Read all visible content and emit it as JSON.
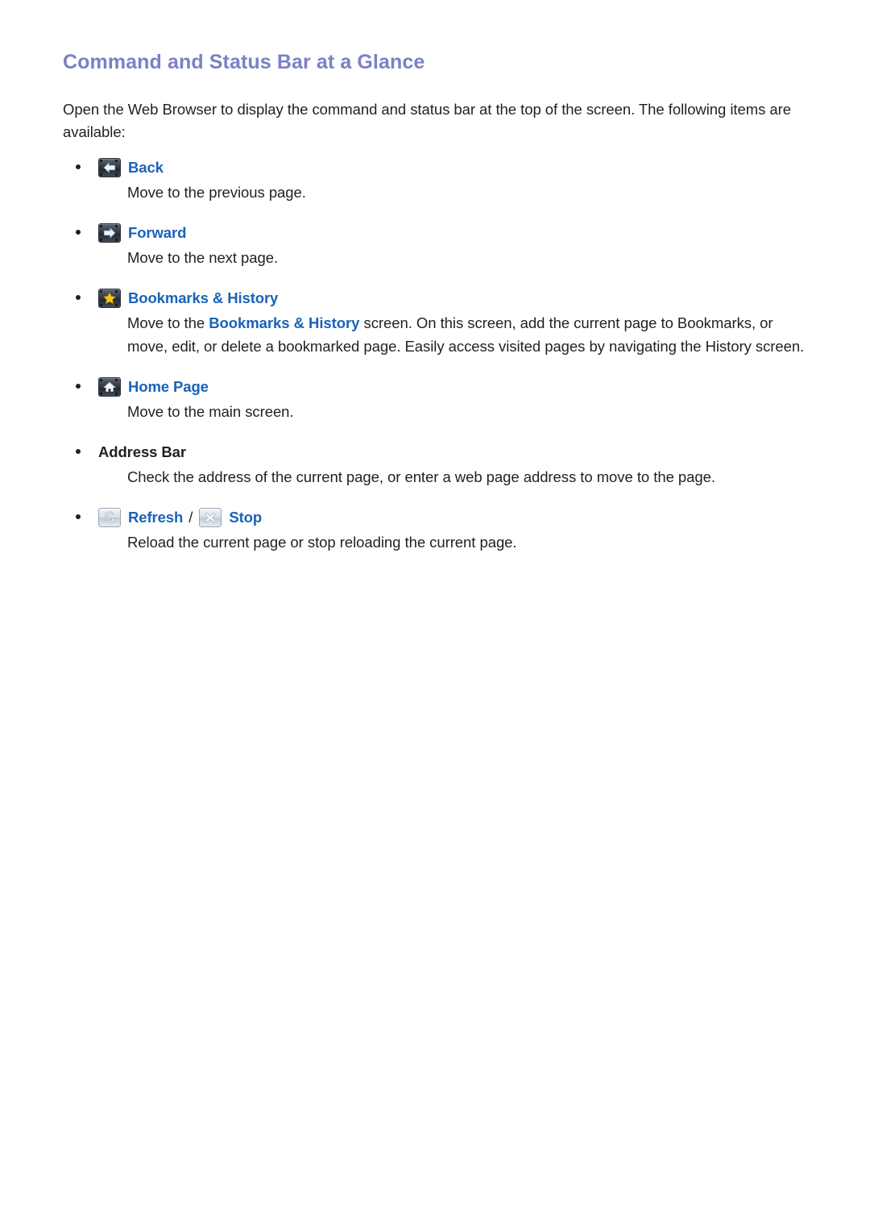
{
  "page": {
    "title": "Command and Status Bar at a Glance",
    "intro": "Open the Web Browser to display the command and status bar at the top of the screen. The following items are available:"
  },
  "colors": {
    "heading": "#7b80c6",
    "link": "#1a62b8",
    "body_text": "#231f20",
    "icon_dark": "#2b313a",
    "icon_light": "#d9e0e7",
    "star_yellow": "#f5c518"
  },
  "items": [
    {
      "icon": "back-arrow-icon",
      "label": "Back",
      "description": "Move to the previous page."
    },
    {
      "icon": "forward-arrow-icon",
      "label": "Forward",
      "description": "Move to the next page."
    },
    {
      "icon": "star-bookmark-icon",
      "label": "Bookmarks & History",
      "description_prefix": "Move to the ",
      "description_highlight": "Bookmarks & History",
      "description_suffix": " screen. On this screen, add the current page to Bookmarks, or move, edit, or delete a bookmarked page. Easily access visited pages by navigating the History screen."
    },
    {
      "icon": "home-icon",
      "label": "Home Page",
      "description": "Move to the main screen."
    },
    {
      "icon": null,
      "label": "Address Bar",
      "description": "Check the address of the current page, or enter a web page address to move to the page."
    },
    {
      "icon": "refresh-icon",
      "label": "Refresh",
      "separator": "/",
      "icon2": "stop-close-icon",
      "label2": "Stop",
      "description": "Reload the current page or stop reloading the current page."
    }
  ]
}
